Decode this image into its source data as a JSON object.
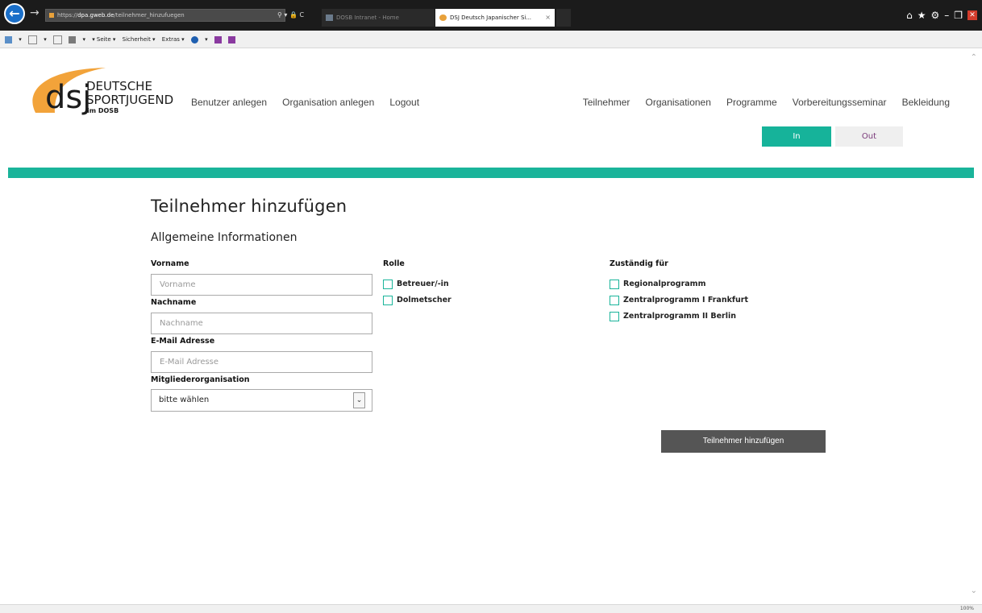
{
  "browser": {
    "address_scheme": "https://",
    "address_host": "dpa.gweb.de",
    "address_path": "/teilnehmer_hinzufuegen",
    "address_tools": "⚲ ▾ 🔒 C",
    "tabs": [
      {
        "title": "DOSB Intranet - Home"
      },
      {
        "title": "DSJ Deutsch Japanischer Si...",
        "close": "×"
      }
    ],
    "commands": [
      "▾",
      "▾",
      "▾",
      "▾ Seite ▾",
      "Sicherheit ▾",
      "Extras ▾",
      "▾"
    ],
    "zoom": "100%"
  },
  "site": {
    "logo_letters": "dsj",
    "logo_line1": "DEUTSCHE",
    "logo_line2": "SPORTJUGEND",
    "logo_line3": "im DOSB",
    "nav_left": [
      "Benutzer anlegen",
      "Organisation anlegen",
      "Logout"
    ],
    "nav_right": [
      "Teilnehmer",
      "Organisationen",
      "Programme",
      "Vorbereitungsseminar",
      "Bekleidung"
    ],
    "toggle_in": "In",
    "toggle_out": "Out"
  },
  "form": {
    "title": "Teilnehmer hinzufügen",
    "section": "Allgemeine Informationen",
    "vorname_label": "Vorname",
    "vorname_placeholder": "Vorname",
    "nachname_label": "Nachname",
    "nachname_placeholder": "Nachname",
    "email_label": "E-Mail Adresse",
    "email_placeholder": "E-Mail Adresse",
    "org_label": "Mitgliederorganisation",
    "org_value": "bitte wählen",
    "rolle_label": "Rolle",
    "rolle_options": [
      "Betreuer/-in",
      "Dolmetscher"
    ],
    "zustaendig_label": "Zuständig für",
    "zustaendig_options": [
      "Regionalprogramm",
      "Zentralprogramm I Frankfurt",
      "Zentralprogramm II Berlin"
    ],
    "submit": "Teilnehmer hinzufügen"
  },
  "colors": {
    "accent": "#1ab49a",
    "logo_orange": "#f2a33a",
    "button_dark": "#555555"
  }
}
